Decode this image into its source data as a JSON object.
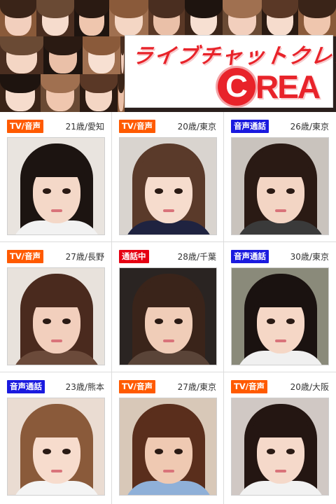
{
  "header": {
    "logo_text_jp": "ライブチャットクレア",
    "logo_c": "C",
    "logo_rest": "REA",
    "colors": {
      "brand_red": "#e8232a",
      "badge_orange": "#ff5a00",
      "badge_blue": "#1a1adf",
      "badge_red": "#e60012"
    }
  },
  "cards": [
    {
      "badge": "TV/音声",
      "badge_color": "#ff5a00",
      "age": "21歳",
      "sep": "/",
      "region": "愛知",
      "hair": "#1c1411",
      "skin": "#f4d8c8",
      "bg": "#e9e4df",
      "top": "#f2f2f2"
    },
    {
      "badge": "TV/音声",
      "badge_color": "#ff5a00",
      "age": "20歳",
      "sep": "/",
      "region": "東京",
      "hair": "#5a3a2a",
      "skin": "#f6dccd",
      "bg": "#d9d4cf",
      "top": "#1f2340"
    },
    {
      "badge": "音声通話",
      "badge_color": "#1a1adf",
      "age": "26歳",
      "sep": "/",
      "region": "東京",
      "hair": "#2a1a14",
      "skin": "#f3d5c4",
      "bg": "#c9c3bd",
      "top": "#3a3a3a"
    },
    {
      "badge": "TV/音声",
      "badge_color": "#ff5a00",
      "age": "27歳",
      "sep": "/",
      "region": "長野",
      "hair": "#4a2a1e",
      "skin": "#f2cfbd",
      "bg": "#e8e2dc",
      "top": "#6b4a3a"
    },
    {
      "badge": "通話中",
      "badge_color": "#e60012",
      "age": "28歳",
      "sep": "/",
      "region": "千葉",
      "hair": "#3a241a",
      "skin": "#f0cdb8",
      "bg": "#2a2422",
      "top": "#5a4438"
    },
    {
      "badge": "音声通話",
      "badge_color": "#1a1adf",
      "age": "30歳",
      "sep": "/",
      "region": "東京",
      "hair": "#1a1210",
      "skin": "#f5d7c6",
      "bg": "#8a8a7a",
      "top": "#f0f0f0"
    },
    {
      "badge": "音声通話",
      "badge_color": "#1a1adf",
      "age": "23歳",
      "sep": "/",
      "region": "熊本",
      "hair": "#8a5a3a",
      "skin": "#f7dccd",
      "bg": "#eadcd2",
      "top": "#f4f4f4"
    },
    {
      "badge": "TV/音声",
      "badge_color": "#ff5a00",
      "age": "27歳",
      "sep": "/",
      "region": "東京",
      "hair": "#5a2e1c",
      "skin": "#efc9b2",
      "bg": "#d8c8b8",
      "top": "#8fb0d8"
    },
    {
      "badge": "TV/音声",
      "badge_color": "#ff5a00",
      "age": "20歳",
      "sep": "/",
      "region": "大阪",
      "hair": "#241612",
      "skin": "#f5d9ca",
      "bg": "#d0c8c4",
      "top": "#f2f2f2"
    }
  ]
}
